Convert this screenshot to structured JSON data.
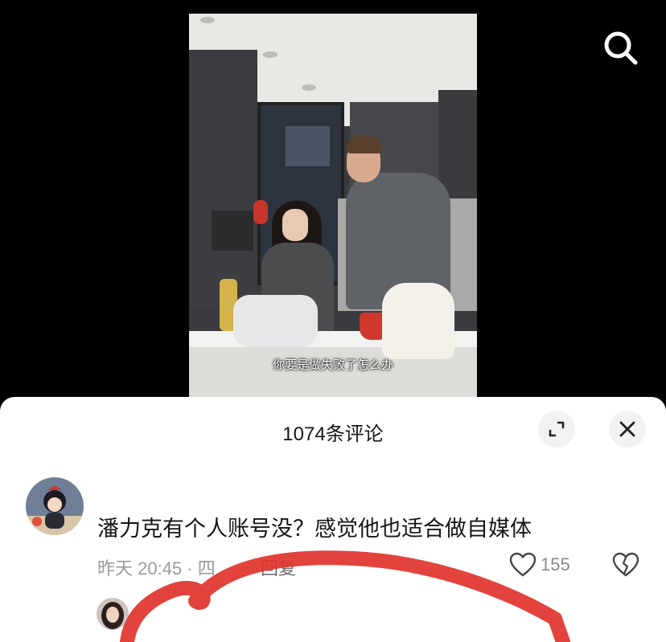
{
  "video": {
    "subtitle": "你要是做失败了怎么办"
  },
  "icons": {
    "search": "search-icon",
    "expand": "expand-icon",
    "close": "close-icon",
    "like": "heart-icon",
    "dislike": "broken-heart-icon"
  },
  "comments_sheet": {
    "title": "1074条评论",
    "comments": [
      {
        "text": "潘力克有个人账号没？感觉他也适合做自媒体",
        "time": "昨天 20:45 · 四",
        "reply_label": "回复",
        "like_count": "155"
      }
    ]
  },
  "colors": {
    "annotation_stroke": "#e0332d",
    "sheet_background": "#ffffff",
    "meta_text": "#9a9a9a"
  }
}
